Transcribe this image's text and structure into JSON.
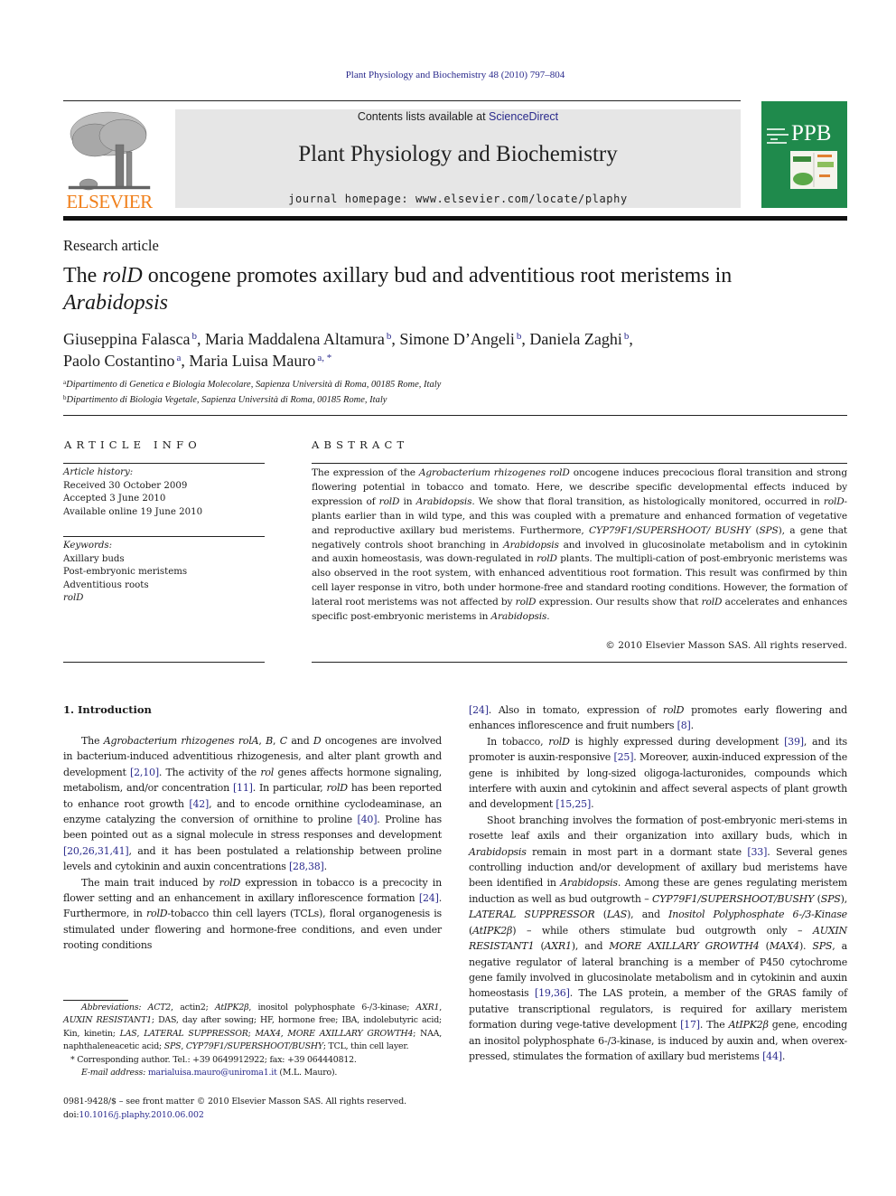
{
  "citation": "Plant Physiology and Biochemistry 48 (2010) 797–804",
  "masthead": {
    "publisher_logo_text": "ELSEVIER",
    "contents_prefix": "Contents lists available at ",
    "contents_link": "ScienceDirect",
    "journal_title": "Plant Physiology and Biochemistry",
    "homepage_line": "journal homepage: www.elsevier.com/locate/plaphy",
    "cover_abbrev": "PPB"
  },
  "colors": {
    "link": "#2a2a8c",
    "elsevier_orange": "#f07f1a",
    "cover_green": "#1f8a4c",
    "masthead_gray": "#e6e6e6"
  },
  "article_type": "Research article",
  "title": {
    "part1": "The ",
    "italic1": "rolD",
    "part2": " oncogene promotes axillary bud and adventitious root meristems in ",
    "italic2": "Arabidopsis"
  },
  "authors": [
    {
      "name": "Giuseppina Falasca",
      "aff": "b",
      "sep": ", "
    },
    {
      "name": "Maria Maddalena Altamura",
      "aff": "b",
      "sep": ", "
    },
    {
      "name": "Simone D’Angeli",
      "aff": "b",
      "sep": ", "
    },
    {
      "name": "Daniela Zaghi",
      "aff": "b",
      "sep": ","
    },
    {
      "name": "Paolo Costantino",
      "aff": "a",
      "sep": ", "
    },
    {
      "name": "Maria Luisa Mauro",
      "aff": "a, *",
      "sep": ""
    }
  ],
  "affiliations": [
    {
      "key": "a",
      "text": "Dipartimento di Genetica e Biologia Molecolare, Sapienza Università di Roma, 00185 Rome, Italy"
    },
    {
      "key": "b",
      "text": "Dipartimento di Biologia Vegetale, Sapienza Università di Roma, 00185 Rome, Italy"
    }
  ],
  "article_info": {
    "heading": "ARTICLE INFO",
    "history_label": "Article history:",
    "received": "Received 30 October 2009",
    "accepted": "Accepted 3 June 2010",
    "online": "Available online 19 June 2010",
    "keywords_label": "Keywords:",
    "keywords": [
      "Axillary buds",
      "Post-embryonic meristems",
      "Adventitious roots",
      "rolD"
    ]
  },
  "abstract": {
    "heading": "ABSTRACT",
    "html": "The expression of the <i>Agrobacterium rhizogenes rolD</i> oncogene induces precocious floral transition and strong flowering potential in tobacco and tomato. Here, we describe specific developmental effects induced by expression of <i>rolD</i> in <i>Arabidopsis</i>. We show that floral transition, as histologically monitored, occurred in <i>rolD</i>- plants earlier than in wild type, and this was coupled with a premature and enhanced formation of vegetative and reproductive axillary bud meristems. Furthermore, <i>CYP79F1/SUPERSHOOT/ BUSHY</i> (<i>SPS</i>), a gene that negatively controls shoot branching in <i>Arabidopsis</i> and involved in glucosinolate metabolism and in cytokinin and auxin homeostasis, was down-regulated in <i>rolD</i> plants. The multipli-cation of post-embryonic meristems was also observed in the root system, with enhanced adventitious root formation. This result was confirmed by thin cell layer response in vitro, both under hormone-free and standard rooting conditions. However, the formation of lateral root meristems was not affected by <i>rolD</i> expression. Our results show that <i>rolD</i> accelerates and enhances specific post-embryonic meristems in <i>Arabidopsis</i>.",
    "copyright": "© 2010 Elsevier Masson SAS. All rights reserved."
  },
  "introduction": {
    "heading": "1.  Introduction",
    "left_paragraphs": [
      "The <i>Agrobacterium rhizogenes rolA</i>, <i>B</i>, <i>C</i> and <i>D</i> oncogenes are involved in bacterium-induced adventitious rhizogenesis, and alter plant growth and development <a>[2,10]</a>. The activity of the <i>rol</i> genes affects hormone signaling, metabolism, and/or concentration <a>[11]</a>. In particular, <i>rolD</i> has been reported to enhance root growth <a>[42]</a>, and to encode ornithine cyclodeaminase, an enzyme catalyzing the conversion of ornithine to proline <a>[40]</a>. Proline has been pointed out as a signal molecule in stress responses and development <a>[20,26,31,41]</a>, and it has been postulated a relationship between proline levels and cytokinin and auxin concentrations <a>[28,38]</a>.",
      "The main trait induced by <i>rolD</i> expression in tobacco is a precocity in flower setting and an enhancement in axillary inflorescence formation <a>[24]</a>. Furthermore, in <i>rolD</i>-tobacco thin cell layers (TCLs), floral organogenesis is stimulated under flowering and hormone-free conditions, and even under rooting conditions"
    ],
    "right_continuation": "<a>[24]</a>. Also in tomato, expression of <i>rolD</i> promotes early flowering and enhances inflorescence and fruit numbers <a>[8]</a>.",
    "right_paragraphs": [
      "In tobacco, <i>rolD</i> is highly expressed during development <a>[39]</a>, and its promoter is auxin-responsive <a>[25]</a>. Moreover, auxin-induced expression of the gene is inhibited by long-sized oligoga-lacturonides, compounds which interfere with auxin and cytokinin and affect several aspects of plant growth and development <a>[15,25]</a>.",
      "Shoot branching involves the formation of post-embryonic meri-stems in rosette leaf axils and their organization into axillary buds, which in <i>Arabidopsis</i> remain in most part in a dormant state <a>[33]</a>. Several genes controlling induction and/or development of axillary bud meristems have been identified in <i>Arabidopsis</i>. Among these are genes regulating meristem induction as well as bud outgrowth – <i>CYP79F1/SUPERSHOOT/BUSHY</i> (<i>SPS</i>), <i>LATERAL SUPPRESSOR</i> (<i>LAS</i>), and <i>Inositol Polyphosphate 6-/3-Kinase</i> (<i>AtIPK2β</i>) – while others stimulate bud outgrowth only – <i>AUXIN RESISTANT1</i> (<i>AXR1</i>), and <i>MORE AXILLARY GROWTH4</i> (<i>MAX4</i>). <i>SPS</i>, a negative regulator of lateral branching is a member of P450 cytochrome gene family involved in glucosinolate metabolism and in cytokinin and auxin homeostasis <a>[19,36]</a>. The LAS protein, a member of the GRAS family of putative transcriptional regulators, is required for axillary meristem formation during vege-tative development <a>[17]</a>. The <i>AtIPK2β</i> gene, encoding an inositol polyphosphate 6-/3-kinase, is induced by auxin and, when overex-pressed, stimulates the formation of axillary bud meristems <a>[44]</a>."
    ]
  },
  "footnotes": {
    "abbreviations_html": "<i>Abbreviations: ACT2</i>, actin2; <i>AtIPK2β</i>, inositol polyphosphate 6-/3-kinase; <i>AXR1</i>, <i>AUXIN RESISTANT1</i>; DAS, day after sowing; HF, hormone free; IBA, indolebutyric acid; Kin, kinetin; <i>LAS</i>, <i>LATERAL SUPPRESSOR</i>; <i>MAX4</i>, <i>MORE AXILLARY GROWTH4</i>; NAA, naphthaleneacetic acid; <i>SPS</i>, <i>CYP79F1/SUPERSHOOT/BUSHY</i>; TCL, thin cell layer.",
    "corresponding": "*  Corresponding author. Tel.: +39 0649912922; fax: +39 064440812.",
    "email_label": "E-mail address: ",
    "email": "marialuisa.mauro@uniroma1.it",
    "email_suffix": " (M.L. Mauro).",
    "front_matter": "0981-9428/$ – see front matter © 2010 Elsevier Masson SAS. All rights reserved.",
    "doi_label": "doi:",
    "doi": "10.1016/j.plaphy.2010.06.002"
  }
}
